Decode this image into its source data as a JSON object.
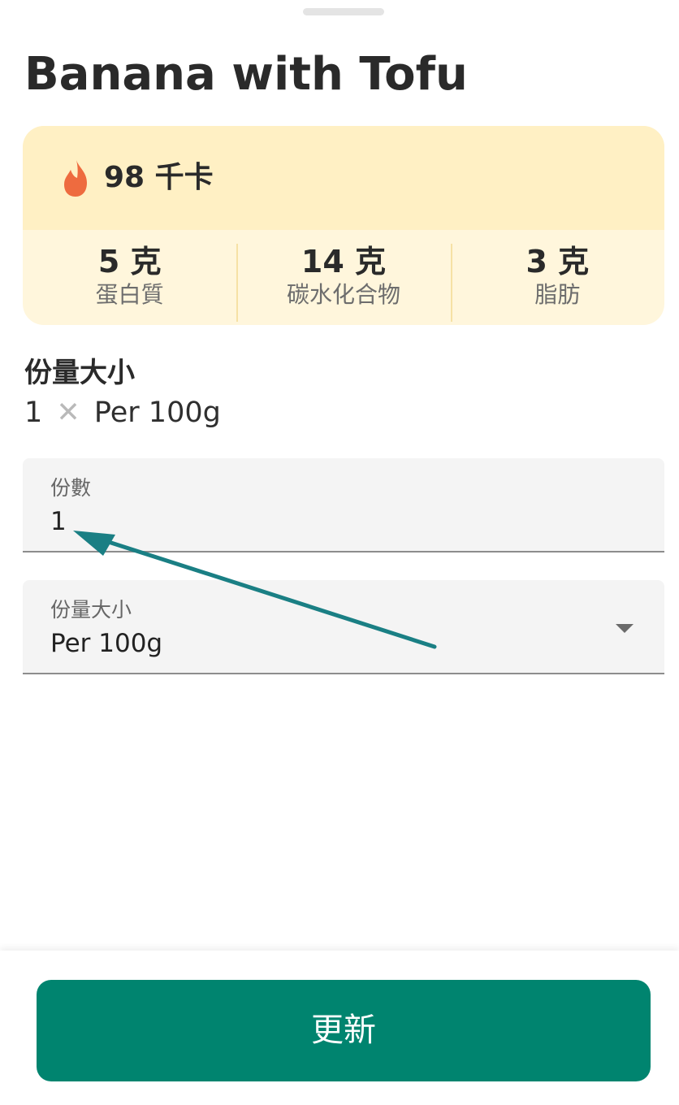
{
  "food": {
    "title": "Banana with Tofu"
  },
  "nutrition": {
    "calories": "98 千卡",
    "macros": [
      {
        "value": "5 克",
        "label": "蛋白質"
      },
      {
        "value": "14 克",
        "label": "碳水化合物"
      },
      {
        "value": "3 克",
        "label": "脂肪"
      }
    ]
  },
  "serving": {
    "heading": "份量大小",
    "summary_count": "1",
    "summary_times": "✕",
    "summary_unit": "Per 100g"
  },
  "fields": {
    "servings": {
      "label": "份數",
      "value": "1"
    },
    "serving_size": {
      "label": "份量大小",
      "selected": "Per 100g"
    }
  },
  "actions": {
    "update_label": "更新"
  },
  "colors": {
    "accent": "#00846f",
    "calorie_bg": "#fff0c4",
    "macro_bg": "#fff6dc",
    "flame": "#ee6b3f",
    "annotation_arrow": "#1a7f84"
  },
  "icons": {
    "calories": "flame-icon",
    "multiply": "times-icon",
    "dropdown": "chevron-down-icon",
    "annotation": "arrow-annotation-icon"
  }
}
